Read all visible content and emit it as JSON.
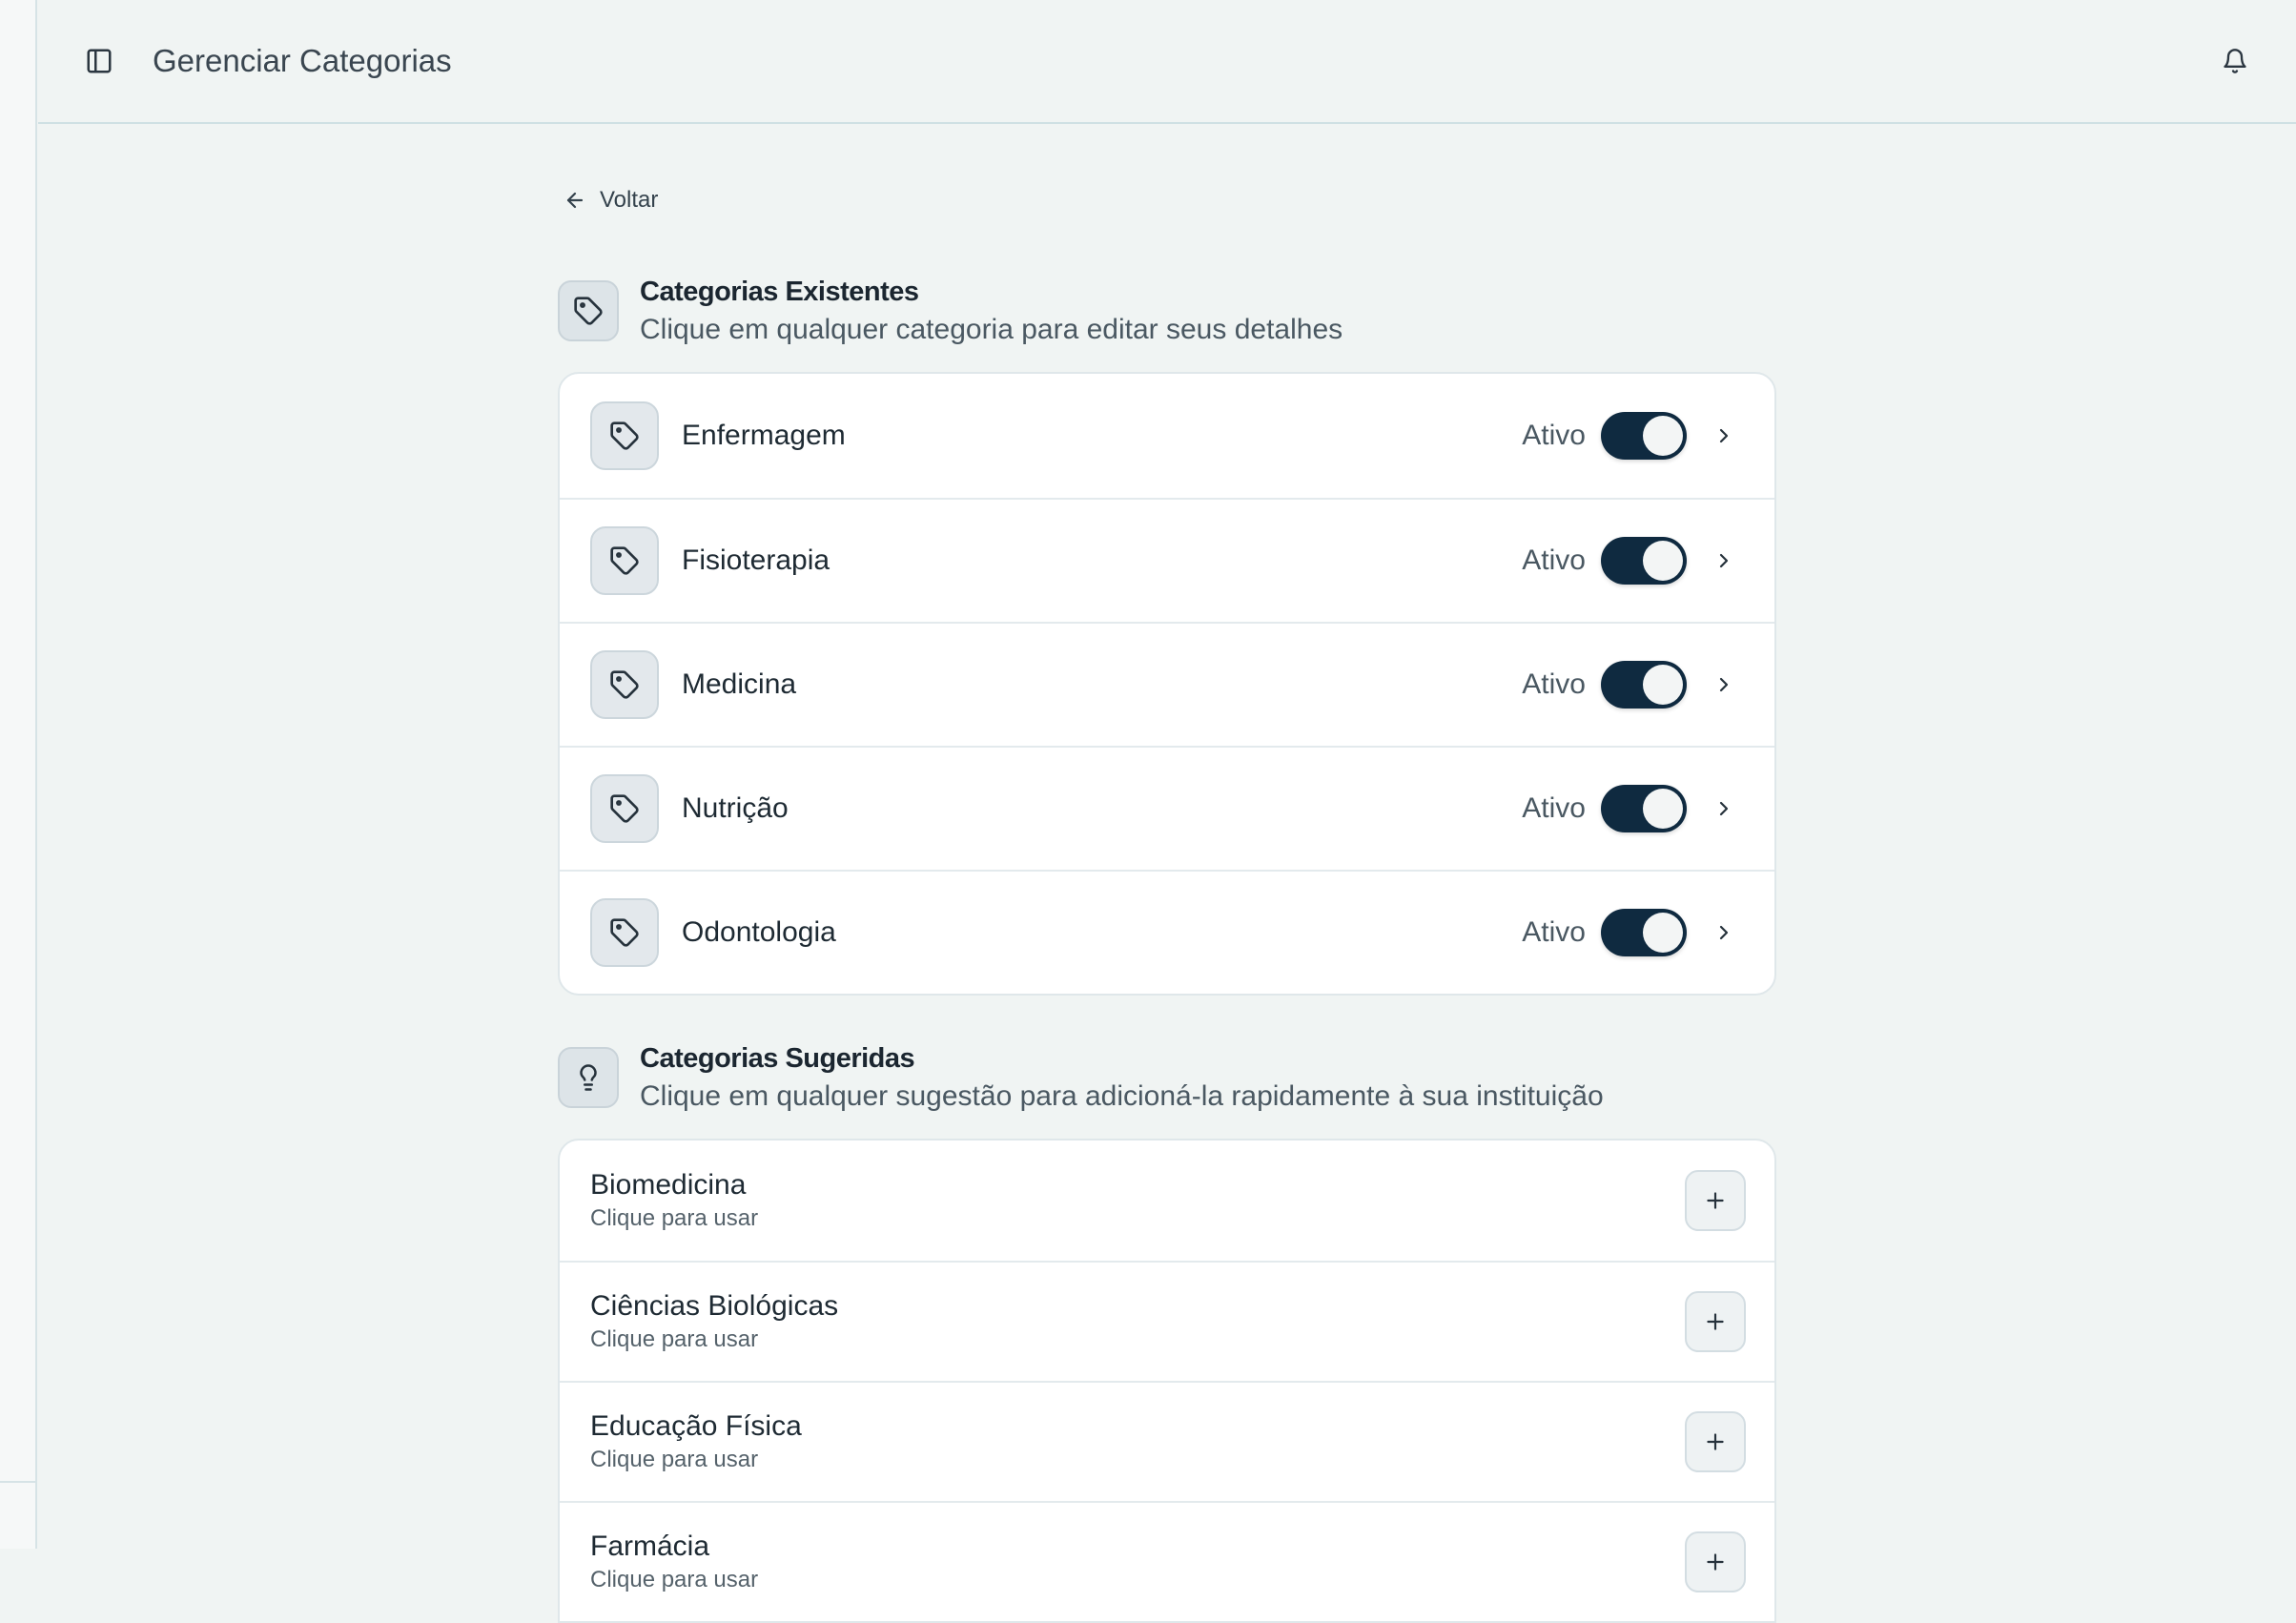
{
  "header": {
    "title": "Gerenciar Categorias"
  },
  "back_label": "Voltar",
  "existing": {
    "title": "Categorias Existentes",
    "subtitle": "Clique em qualquer categoria para editar seus detalhes",
    "items": [
      {
        "name": "Enfermagem",
        "status": "Ativo",
        "active": true
      },
      {
        "name": "Fisioterapia",
        "status": "Ativo",
        "active": true
      },
      {
        "name": "Medicina",
        "status": "Ativo",
        "active": true
      },
      {
        "name": "Nutrição",
        "status": "Ativo",
        "active": true
      },
      {
        "name": "Odontologia",
        "status": "Ativo",
        "active": true
      }
    ]
  },
  "suggested": {
    "title": "Categorias Sugeridas",
    "subtitle": "Clique em qualquer sugestão para adicioná-la rapidamente à sua instituição",
    "items": [
      {
        "name": "Biomedicina",
        "hint": "Clique para usar"
      },
      {
        "name": "Ciências Biológicas",
        "hint": "Clique para usar"
      },
      {
        "name": "Educação Física",
        "hint": "Clique para usar"
      },
      {
        "name": "Farmácia",
        "hint": "Clique para usar"
      }
    ]
  },
  "colors": {
    "accent": "#0f2a40",
    "background": "#f0f4f3",
    "card": "#ffffff"
  },
  "icons": {
    "sidebar_toggle": "sidebar-panel-icon",
    "notifications": "bell-icon",
    "back": "arrow-left-icon",
    "category": "tag-icon",
    "suggestions": "lightbulb-icon",
    "row_open": "chevron-right-icon",
    "add": "plus-icon"
  }
}
